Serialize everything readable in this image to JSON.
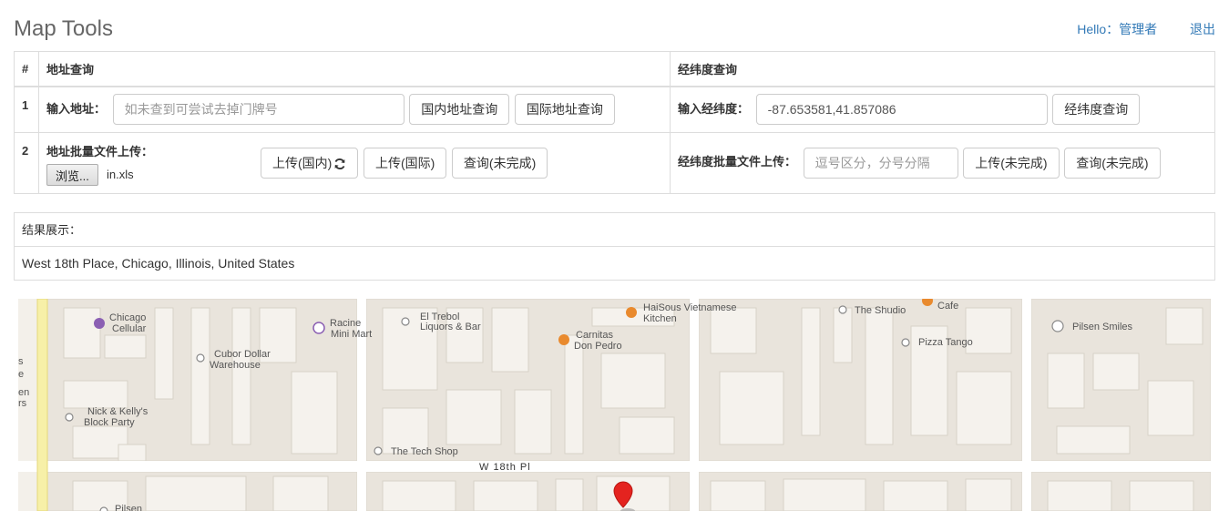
{
  "header": {
    "title": "Map Tools",
    "hello": "Hello：管理者",
    "logout": "退出"
  },
  "table": {
    "col_num": "#",
    "col_address": "地址查询",
    "col_latlng": "经纬度查询",
    "row1": {
      "num": "1",
      "address_label": "输入地址：",
      "address_placeholder": "如未查到可尝试去掉门牌号",
      "domestic_btn": "国内地址查询",
      "intl_btn": "国际地址查询",
      "latlng_label": "输入经纬度：",
      "latlng_value": "-87.653581,41.857086",
      "latlng_btn": "经纬度查询"
    },
    "row2": {
      "num": "2",
      "batch_label": "地址批量文件上传：",
      "browse_btn": "浏览...",
      "file_name": "in.xls",
      "upload_domestic": "上传(国内)",
      "upload_intl": "上传(国际)",
      "query_btn": "查询(未完成)",
      "latlng_batch_label": "经纬度批量文件上传：",
      "latlng_batch_placeholder": "逗号区分，分号分隔",
      "latlng_upload_btn": "上传(未完成)",
      "latlng_query_btn": "查询(未完成)"
    }
  },
  "result": {
    "heading": "结果展示：",
    "text": "West 18th Place, Chicago, Illinois, United States"
  },
  "map": {
    "street": "W 18th Pl",
    "pois": [
      {
        "name_1": "Chicago",
        "name_2": "Cellular"
      },
      {
        "name_1": "Racine",
        "name_2": "Mini Mart"
      },
      {
        "name_1": "El Trebol",
        "name_2": "Liquors & Bar"
      },
      {
        "name_1": "HaiSous Vietnamese",
        "name_2": "Kitchen"
      },
      {
        "name_1": "The Shudio"
      },
      {
        "name_1": "Cafe"
      },
      {
        "name_1": "Pilsen Smiles"
      },
      {
        "name_1": "Cubor Dollar",
        "name_2": "Warehouse"
      },
      {
        "name_1": "Carnitas",
        "name_2": "Don Pedro"
      },
      {
        "name_1": "Pizza Tango"
      },
      {
        "name_1": "Nick & Kelly's",
        "name_2": "Block Party"
      },
      {
        "name_1": "The Tech Shop"
      },
      {
        "name_1": "Pilsen"
      }
    ],
    "edge_fragments": [
      "s",
      "e",
      "en",
      "rs"
    ],
    "marker_color": "#e4231f",
    "road_color": "#f7f0a8"
  }
}
